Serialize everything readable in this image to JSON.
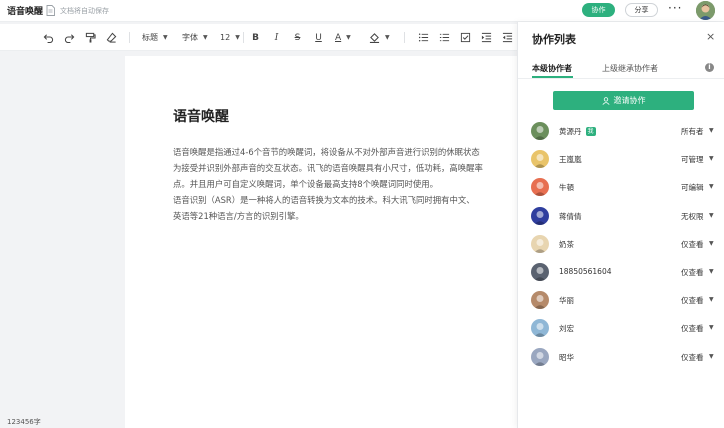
{
  "topbar": {
    "title": "语音唤醒",
    "autosave": "文档将自动保存",
    "collab_label": "协作",
    "share_label": "分享",
    "more_label": "···"
  },
  "toolbar": {
    "heading_label": "标题",
    "font_label": "字体",
    "size_label": "12",
    "text_color_label": "A"
  },
  "document": {
    "heading": "语音唤醒",
    "paragraphs": [
      "语音唤醒是指通过4-6个音节的唤醒词，将设备从不对外部声音进行识别的休眠状态",
      "为接受并识别外部声音的交互状态。讯飞的语音唤醒具有小尺寸，低功耗，高唤醒率",
      "点。并且用户可自定义唤醒词，单个设备最高支持8个唤醒词同时使用。",
      "语音识别（ASR）是一种将人的语音转换为文本的技术。科大讯飞同时拥有中文、",
      "英语等21种语言/方言的识别引擎。"
    ]
  },
  "status": {
    "word_count": "123456字"
  },
  "panel": {
    "title": "协作列表",
    "close_label": "×",
    "tab_local": "本级协作者",
    "tab_inherit": "上级继承协作者",
    "info_label": "i",
    "invite_label": "邀请协作",
    "members": [
      {
        "name": "黄源丹",
        "badge": "我",
        "permission": "所有者",
        "avatar_color": "#6b8f5c"
      },
      {
        "name": "王嵐嵐",
        "badge": "",
        "permission": "可管理",
        "avatar_color": "#e9c46a"
      },
      {
        "name": "牛頓",
        "badge": "",
        "permission": "可编辑",
        "avatar_color": "#e76f51"
      },
      {
        "name": "蒋倩倩",
        "badge": "",
        "permission": "无权限",
        "avatar_color": "#2f3e9e"
      },
      {
        "name": "奶茶",
        "badge": "",
        "permission": "仅查看",
        "avatar_color": "#e8d5b0"
      },
      {
        "name": "18850561604",
        "badge": "",
        "permission": "仅查看",
        "avatar_color": "#5a6270"
      },
      {
        "name": "华丽",
        "badge": "",
        "permission": "仅查看",
        "avatar_color": "#b58a6a"
      },
      {
        "name": "刘宏",
        "badge": "",
        "permission": "仅查看",
        "avatar_color": "#8fb7d6"
      },
      {
        "name": "昭华",
        "badge": "",
        "permission": "仅查看",
        "avatar_color": "#9aa7c0"
      }
    ]
  },
  "colors": {
    "accent": "#2db07e"
  },
  "icons": [
    "doc-icon",
    "undo-icon",
    "redo-icon",
    "format-painter-icon",
    "eraser-icon",
    "bold-icon",
    "italic-icon",
    "strikethrough-icon",
    "underline-icon",
    "highlight-icon",
    "ordered-list-icon",
    "bullet-list-icon",
    "checkbox-icon",
    "indent-icon",
    "outdent-icon",
    "close-icon",
    "info-icon",
    "user-icon",
    "chevron-down-icon"
  ]
}
